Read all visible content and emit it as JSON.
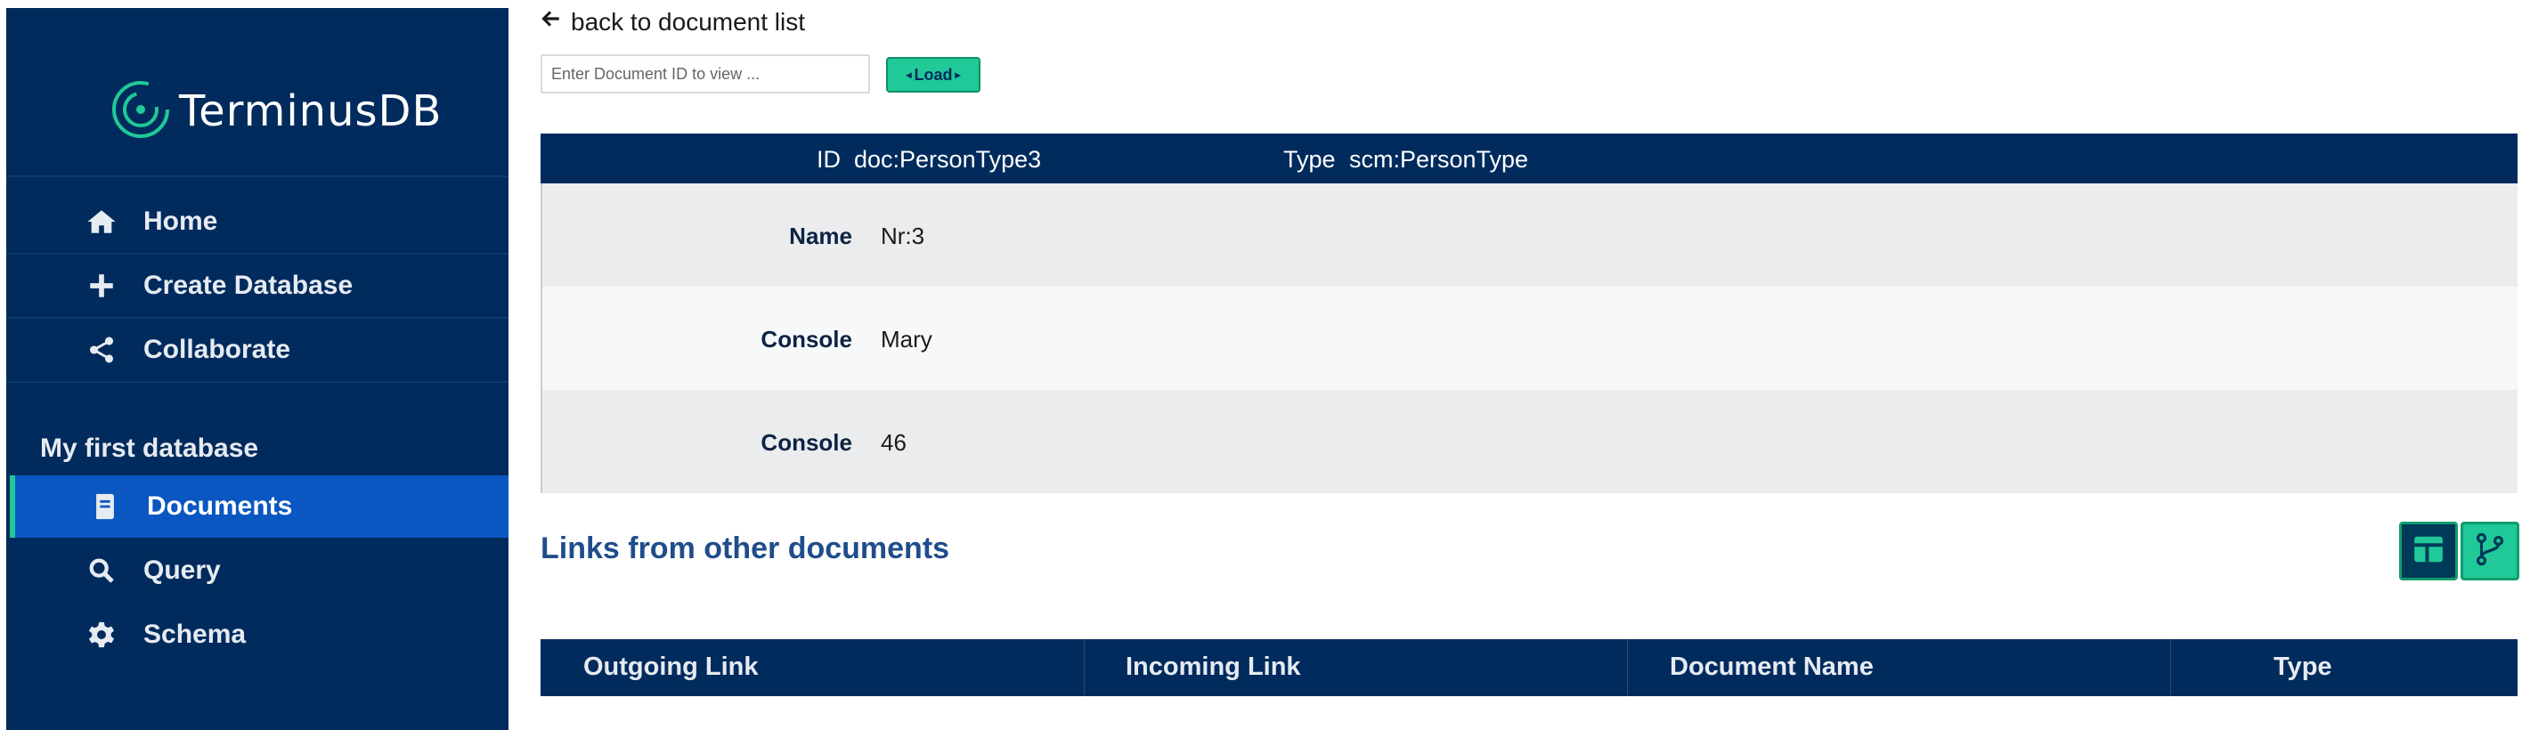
{
  "sidebar": {
    "logo_text": "TerminusDB",
    "items": [
      {
        "label": "Home",
        "icon": "home-icon"
      },
      {
        "label": "Create Database",
        "icon": "plus-icon"
      },
      {
        "label": "Collaborate",
        "icon": "share-icon"
      }
    ],
    "database_heading": "My first database",
    "db_items": [
      {
        "label": "Documents",
        "icon": "document-icon",
        "active": true
      },
      {
        "label": "Query",
        "icon": "search-icon"
      },
      {
        "label": "Schema",
        "icon": "gear-icon"
      }
    ],
    "accent_color": "#20c997",
    "background_color": "#002b5c",
    "active_color": "#0a57c2"
  },
  "main": {
    "back_link": "back to document list",
    "doc_id_placeholder": "Enter Document ID to view ...",
    "load_label": "Load",
    "document": {
      "id_label": "ID",
      "id_value": "doc:PersonType3",
      "type_label": "Type",
      "type_value": "scm:PersonType",
      "rows": [
        {
          "label": "Name",
          "value": "Nr:3"
        },
        {
          "label": "Console",
          "value": "Mary"
        },
        {
          "label": "Console",
          "value": "46"
        }
      ]
    },
    "links_title": "Links from other documents",
    "links_table": {
      "columns": [
        "Outgoing Link",
        "Incoming Link",
        "Document Name",
        "Type"
      ]
    },
    "view_buttons": [
      "table-view-icon",
      "graph-view-icon"
    ]
  }
}
